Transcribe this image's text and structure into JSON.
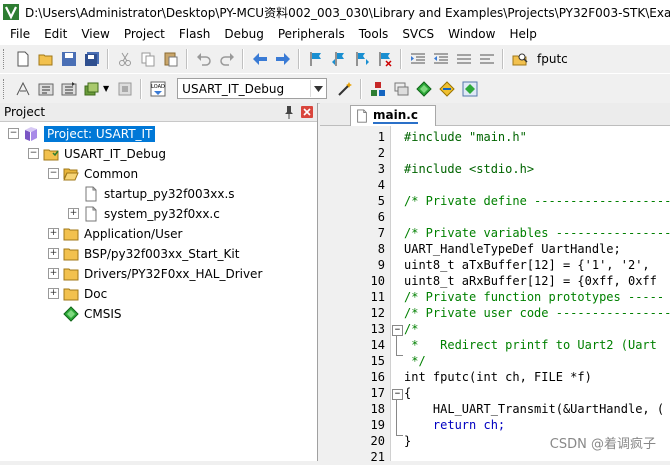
{
  "window": {
    "title": "D:\\Users\\Administrator\\Desktop\\PY-MCU资料002_003_030\\Library and Examples\\Projects\\PY32F003-STK\\Exam"
  },
  "menu": [
    "File",
    "Edit",
    "View",
    "Project",
    "Flash",
    "Debug",
    "Peripherals",
    "Tools",
    "SVCS",
    "Window",
    "Help"
  ],
  "toolbar": {
    "find_text": "fputc",
    "target": "USART_IT_Debug"
  },
  "project_panel": {
    "title": "Project",
    "tree": [
      {
        "label": "Project: USART_IT",
        "level": 0,
        "expander": "-",
        "icon": "project-icon",
        "selected": true
      },
      {
        "label": "USART_IT_Debug",
        "level": 1,
        "expander": "-",
        "icon": "target-folder-icon"
      },
      {
        "label": "Common",
        "level": 2,
        "expander": "-",
        "icon": "folder-open-icon"
      },
      {
        "label": "startup_py32f003xx.s",
        "level": 3,
        "expander": "",
        "icon": "file-icon"
      },
      {
        "label": "system_py32f0xx.c",
        "level": 3,
        "expander": "+",
        "icon": "file-icon"
      },
      {
        "label": "Application/User",
        "level": 2,
        "expander": "+",
        "icon": "folder-icon"
      },
      {
        "label": "BSP/py32f003xx_Start_Kit",
        "level": 2,
        "expander": "+",
        "icon": "folder-icon"
      },
      {
        "label": "Drivers/PY32F0xx_HAL_Driver",
        "level": 2,
        "expander": "+",
        "icon": "folder-icon"
      },
      {
        "label": "Doc",
        "level": 2,
        "expander": "+",
        "icon": "folder-icon"
      },
      {
        "label": "CMSIS",
        "level": 2,
        "expander": "",
        "icon": "diamond-component-icon"
      }
    ]
  },
  "editor": {
    "tab_label": "main.c",
    "lines": [
      {
        "n": "1",
        "text": "#include \"main.h\"",
        "cls": "pp"
      },
      {
        "n": "2",
        "text": "",
        "cls": ""
      },
      {
        "n": "3",
        "text": "#include <stdio.h>",
        "cls": "pp"
      },
      {
        "n": "4",
        "text": "",
        "cls": ""
      },
      {
        "n": "5",
        "text": "/* Private define -------------------",
        "cls": "cm"
      },
      {
        "n": "6",
        "text": "",
        "cls": ""
      },
      {
        "n": "7",
        "text": "/* Private variables ----------------",
        "cls": "cm"
      },
      {
        "n": "8",
        "text": "UART_HandleTypeDef UartHandle;",
        "cls": ""
      },
      {
        "n": "9",
        "text": "uint8_t aTxBuffer[12] = {'1', '2',",
        "cls": ""
      },
      {
        "n": "10",
        "text": "uint8_t aRxBuffer[12] = {0xff, 0xff",
        "cls": ""
      },
      {
        "n": "11",
        "text": "/* Private function prototypes -----",
        "cls": "cm"
      },
      {
        "n": "12",
        "text": "/* Private user code ----------------",
        "cls": "cm"
      },
      {
        "n": "13",
        "text": "/*",
        "cls": "cm"
      },
      {
        "n": "14",
        "text": " *   Redirect printf to Uart2 (Uart",
        "cls": "cm"
      },
      {
        "n": "15",
        "text": " */",
        "cls": "cm"
      },
      {
        "n": "16",
        "text": "int fputc(int ch, FILE *f)",
        "cls": ""
      },
      {
        "n": "17",
        "text": "{",
        "cls": ""
      },
      {
        "n": "18",
        "text": "    HAL_UART_Transmit(&UartHandle, (",
        "cls": ""
      },
      {
        "n": "19",
        "text": "    return ch;",
        "cls": ""
      },
      {
        "n": "20",
        "text": "}",
        "cls": ""
      },
      {
        "n": "21",
        "text": "",
        "cls": ""
      }
    ]
  },
  "watermark": "CSDN @着调疯子"
}
